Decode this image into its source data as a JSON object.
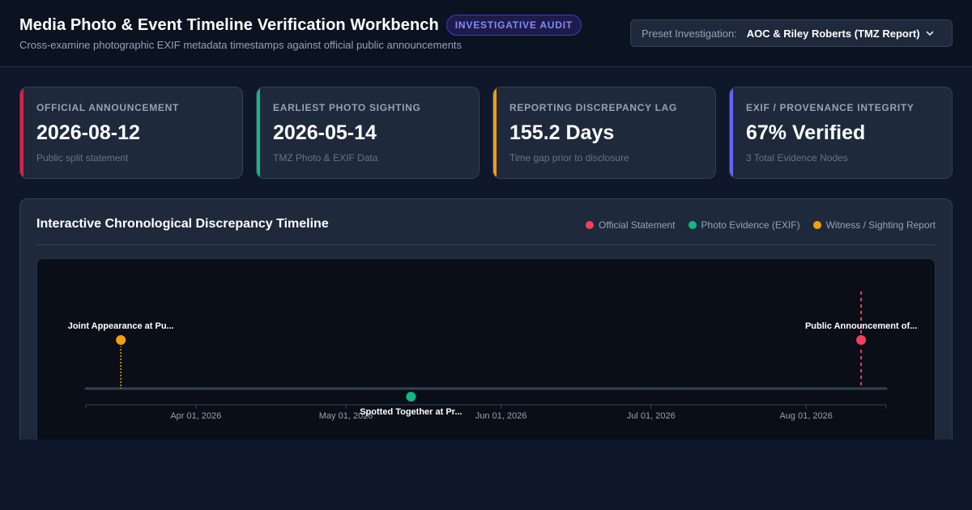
{
  "header": {
    "title": "Media Photo & Event Timeline Verification Workbench",
    "badge": "INVESTIGATIVE AUDIT",
    "subtitle": "Cross-examine photographic EXIF metadata timestamps against official public announcements",
    "preset_label": "Preset Investigation:",
    "preset_value": "AOC & Riley Roberts (TMZ Report)",
    "preset_icon": "chevron-down-icon"
  },
  "cards": [
    {
      "label": "OFFICIAL ANNOUNCEMENT",
      "value": "2026-08-12",
      "note": "Public split statement",
      "accent": "#e11d48"
    },
    {
      "label": "EARLIEST PHOTO SIGHTING",
      "value": "2026-05-14",
      "note": "TMZ Photo & EXIF Data",
      "accent": "#10b981"
    },
    {
      "label": "REPORTING DISCREPANCY LAG",
      "value": "155.2 Days",
      "note": "Time gap prior to disclosure",
      "accent": "#f59e0b"
    },
    {
      "label": "EXIF / PROVENANCE INTEGRITY",
      "value": "67% Verified",
      "note": "3 Total Evidence Nodes",
      "accent": "#6366f1"
    }
  ],
  "timeline": {
    "title": "Interactive Chronological Discrepancy Timeline",
    "legend": [
      {
        "label": "Official Statement",
        "color": "#f43f5e"
      },
      {
        "label": "Photo Evidence (EXIF)",
        "color": "#10b981"
      },
      {
        "label": "Witness / Sighting Report",
        "color": "#f59e0b"
      }
    ],
    "range": {
      "start": "2026-03-10",
      "end": "2026-08-17"
    },
    "ticks": [
      {
        "label": "Apr 01, 2026",
        "date": "2026-04-01"
      },
      {
        "label": "May 01, 2026",
        "date": "2026-05-01"
      },
      {
        "label": "Jun 01, 2026",
        "date": "2026-06-01"
      },
      {
        "label": "Jul 01, 2026",
        "date": "2026-07-01"
      },
      {
        "label": "Aug 01, 2026",
        "date": "2026-08-01"
      }
    ],
    "events": [
      {
        "label": "Joint Appearance at Pu...",
        "date": "2026-03-17",
        "type": "witness",
        "color": "#f59e0b",
        "side": "above"
      },
      {
        "label": "Spotted Together at Pr...",
        "date": "2026-05-14",
        "type": "photo",
        "color": "#10b981",
        "side": "below"
      },
      {
        "label": "Public Announcement of...",
        "date": "2026-08-12",
        "type": "official",
        "color": "#f43f5e",
        "side": "above"
      }
    ]
  }
}
